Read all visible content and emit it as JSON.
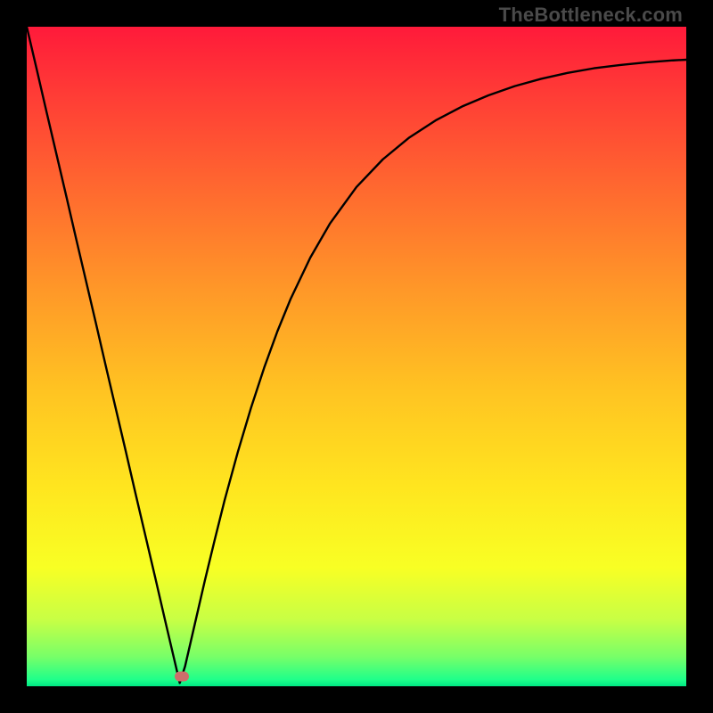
{
  "watermark": "TheBottleneck.com",
  "gradient_stops": [
    {
      "offset": 0.0,
      "color": "#ff1a3a"
    },
    {
      "offset": 0.1,
      "color": "#ff3b36"
    },
    {
      "offset": 0.25,
      "color": "#ff6a2f"
    },
    {
      "offset": 0.4,
      "color": "#ff9828"
    },
    {
      "offset": 0.55,
      "color": "#ffc322"
    },
    {
      "offset": 0.7,
      "color": "#ffe61f"
    },
    {
      "offset": 0.82,
      "color": "#f8ff24"
    },
    {
      "offset": 0.9,
      "color": "#c7ff45"
    },
    {
      "offset": 0.955,
      "color": "#78ff68"
    },
    {
      "offset": 0.99,
      "color": "#1fff8a"
    },
    {
      "offset": 1.0,
      "color": "#00e884"
    }
  ],
  "marker": {
    "x_frac": 0.235,
    "y_frac": 0.985,
    "color": "#cd6e6b"
  },
  "chart_data": {
    "type": "line",
    "title": "",
    "xlabel": "",
    "ylabel": "",
    "xlim": [
      0,
      1
    ],
    "ylim": [
      0,
      1
    ],
    "grid": false,
    "legend": false,
    "background": "vertical-gradient",
    "series": [
      {
        "name": "curve",
        "color": "#000000",
        "x": [
          0.0,
          0.015,
          0.03,
          0.045,
          0.06,
          0.075,
          0.09,
          0.105,
          0.12,
          0.135,
          0.15,
          0.165,
          0.18,
          0.195,
          0.21,
          0.225,
          0.232,
          0.24,
          0.255,
          0.27,
          0.285,
          0.3,
          0.32,
          0.34,
          0.36,
          0.38,
          0.4,
          0.43,
          0.46,
          0.5,
          0.54,
          0.58,
          0.62,
          0.66,
          0.7,
          0.74,
          0.78,
          0.82,
          0.86,
          0.9,
          0.94,
          0.98,
          1.0
        ],
        "y": [
          1.0,
          0.936,
          0.871,
          0.807,
          0.743,
          0.678,
          0.614,
          0.55,
          0.485,
          0.421,
          0.357,
          0.292,
          0.228,
          0.164,
          0.099,
          0.035,
          0.005,
          0.03,
          0.095,
          0.16,
          0.222,
          0.282,
          0.355,
          0.422,
          0.483,
          0.538,
          0.587,
          0.65,
          0.702,
          0.757,
          0.799,
          0.832,
          0.858,
          0.879,
          0.896,
          0.91,
          0.921,
          0.93,
          0.937,
          0.942,
          0.946,
          0.949,
          0.95
        ]
      }
    ],
    "markers": [
      {
        "x": 0.235,
        "y": 0.015,
        "shape": "pill",
        "color": "#cd6e6b"
      }
    ]
  }
}
